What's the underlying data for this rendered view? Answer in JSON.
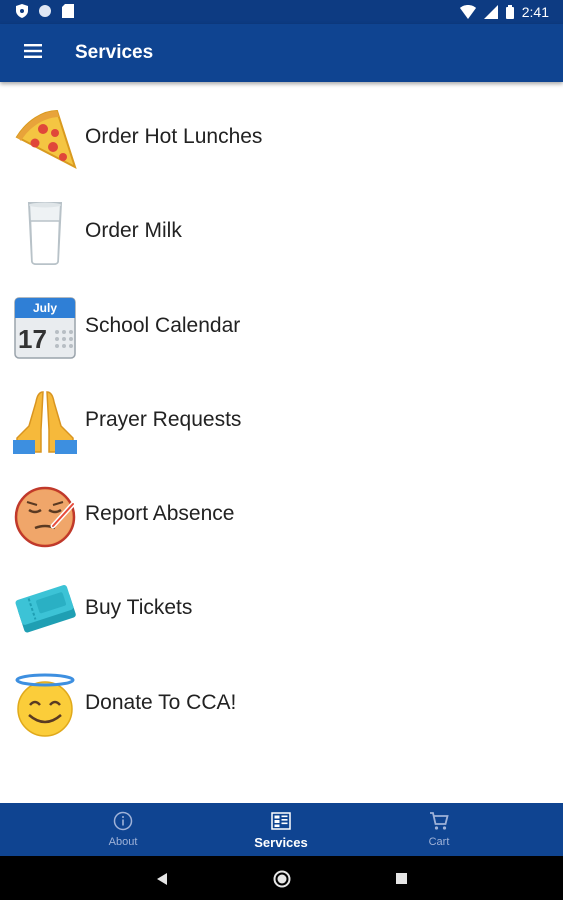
{
  "status_bar": {
    "time": "2:41"
  },
  "app_bar": {
    "title": "Services"
  },
  "services": [
    {
      "label": "Order Hot Lunches",
      "icon": "pizza-icon"
    },
    {
      "label": "Order Milk",
      "icon": "milk-glass-icon"
    },
    {
      "label": "School Calendar",
      "icon": "calendar-icon",
      "icon_month": "July",
      "icon_day": "17"
    },
    {
      "label": "Prayer Requests",
      "icon": "praying-hands-icon"
    },
    {
      "label": "Report Absence",
      "icon": "sick-face-icon"
    },
    {
      "label": "Buy Tickets",
      "icon": "tickets-icon"
    },
    {
      "label": "Donate To CCA!",
      "icon": "angel-face-icon"
    }
  ],
  "bottom_nav": {
    "about": "About",
    "services": "Services",
    "cart": "Cart",
    "active": "Services"
  },
  "colors": {
    "primary": "#0f4491",
    "status_bar": "#0d3b82"
  }
}
